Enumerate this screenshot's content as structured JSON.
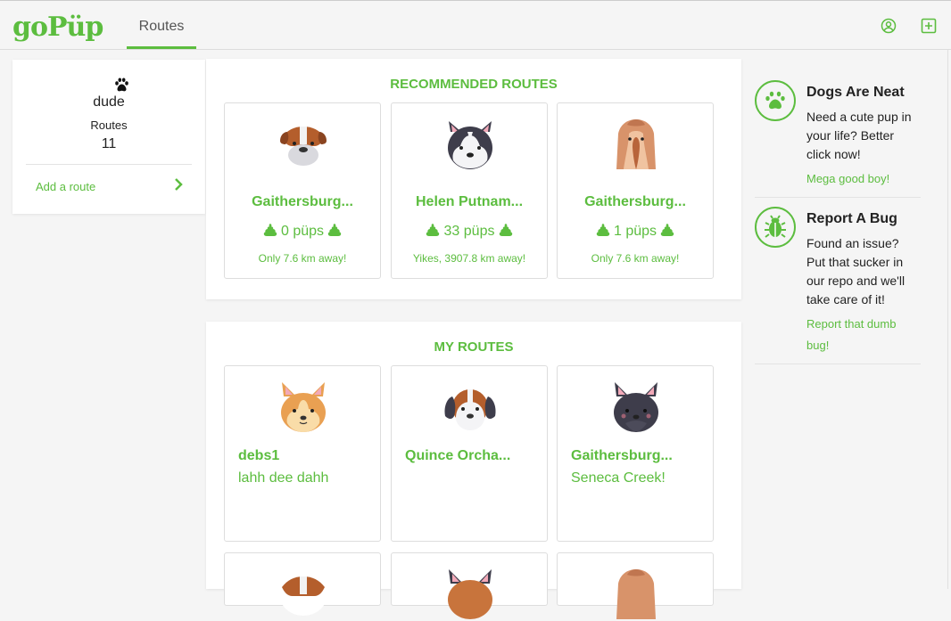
{
  "app": {
    "logo": "goPüp"
  },
  "nav": {
    "routes_tab": "Routes"
  },
  "icons": {
    "account": "account-circle-icon",
    "add": "add-box-icon"
  },
  "profile": {
    "name": "dude",
    "routes_label": "Routes",
    "routes_count": "11",
    "add_route": "Add a route"
  },
  "recommended": {
    "title": "RECOMMENDED ROUTES",
    "items": [
      {
        "name": "Gaithersburg...",
        "pups": "0 püps",
        "distance": "Only 7.6 km away!",
        "dog": "bulldog-icon"
      },
      {
        "name": "Helen Putnam...",
        "pups": "33 püps",
        "distance": "Yikes, 3907.8 km away!",
        "dog": "husky-icon"
      },
      {
        "name": "Gaithersburg...",
        "pups": "1 püps",
        "distance": "Only 7.6 km away!",
        "dog": "afghan-hound-icon"
      }
    ]
  },
  "my_routes": {
    "title": "MY ROUTES",
    "items": [
      {
        "name": "debs1",
        "desc": "lahh dee dahh",
        "dog": "corgi-icon"
      },
      {
        "name": "Quince Orcha...",
        "desc": "",
        "dog": "beagle-icon"
      },
      {
        "name": "Gaithersburg...",
        "desc": "Seneca Creek!",
        "dog": "black-cat-dog-icon"
      }
    ]
  },
  "sidebar": {
    "dogs": {
      "title": "Dogs Are Neat",
      "text": "Need a cute pup in your life? Better click now!",
      "link": "Mega good boy!"
    },
    "bug": {
      "title": "Report A Bug",
      "text": "Found an issue? Put that sucker in our repo and we'll take care of it!",
      "link": "Report that dumb bug!"
    }
  },
  "colors": {
    "accent": "#5cbd3f",
    "background": "#f5f5f5"
  }
}
